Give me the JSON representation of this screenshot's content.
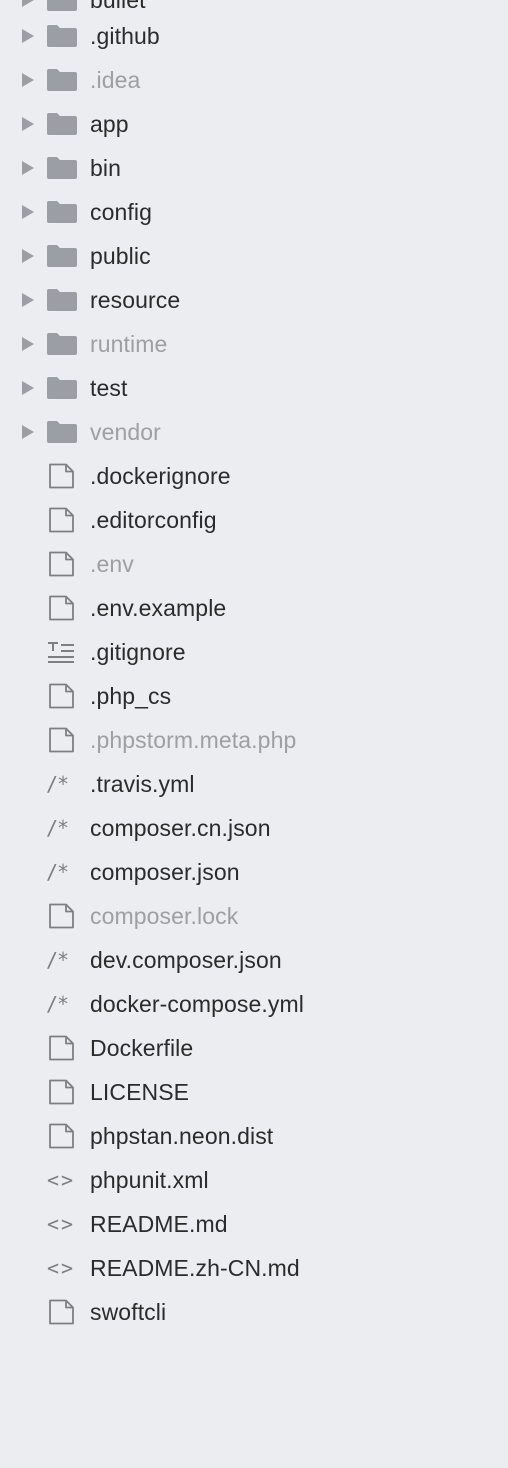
{
  "partial_top_item": {
    "name": "bullet",
    "kind": "folder"
  },
  "items": [
    {
      "name": ".github",
      "kind": "folder",
      "dim": false,
      "icon": "folder-icon"
    },
    {
      "name": ".idea",
      "kind": "folder",
      "dim": true,
      "icon": "folder-icon"
    },
    {
      "name": "app",
      "kind": "folder",
      "dim": false,
      "icon": "folder-icon"
    },
    {
      "name": "bin",
      "kind": "folder",
      "dim": false,
      "icon": "folder-icon"
    },
    {
      "name": "config",
      "kind": "folder",
      "dim": false,
      "icon": "folder-icon"
    },
    {
      "name": "public",
      "kind": "folder",
      "dim": false,
      "icon": "folder-icon"
    },
    {
      "name": "resource",
      "kind": "folder",
      "dim": false,
      "icon": "folder-icon"
    },
    {
      "name": "runtime",
      "kind": "folder",
      "dim": true,
      "icon": "folder-icon"
    },
    {
      "name": "test",
      "kind": "folder",
      "dim": false,
      "icon": "folder-icon"
    },
    {
      "name": "vendor",
      "kind": "folder",
      "dim": true,
      "icon": "folder-icon"
    },
    {
      "name": ".dockerignore",
      "kind": "file",
      "dim": false,
      "icon": "document-icon"
    },
    {
      "name": ".editorconfig",
      "kind": "file",
      "dim": false,
      "icon": "document-icon"
    },
    {
      "name": ".env",
      "kind": "file",
      "dim": true,
      "icon": "document-icon"
    },
    {
      "name": ".env.example",
      "kind": "file",
      "dim": false,
      "icon": "document-icon"
    },
    {
      "name": ".gitignore",
      "kind": "file",
      "dim": false,
      "icon": "text-lines-icon"
    },
    {
      "name": ".php_cs",
      "kind": "file",
      "dim": false,
      "icon": "document-icon"
    },
    {
      "name": ".phpstorm.meta.php",
      "kind": "file",
      "dim": true,
      "icon": "document-icon"
    },
    {
      "name": ".travis.yml",
      "kind": "file",
      "dim": false,
      "icon": "comment-icon"
    },
    {
      "name": "composer.cn.json",
      "kind": "file",
      "dim": false,
      "icon": "comment-icon"
    },
    {
      "name": "composer.json",
      "kind": "file",
      "dim": false,
      "icon": "comment-icon"
    },
    {
      "name": "composer.lock",
      "kind": "file",
      "dim": true,
      "icon": "document-icon"
    },
    {
      "name": "dev.composer.json",
      "kind": "file",
      "dim": false,
      "icon": "comment-icon"
    },
    {
      "name": "docker-compose.yml",
      "kind": "file",
      "dim": false,
      "icon": "comment-icon"
    },
    {
      "name": "Dockerfile",
      "kind": "file",
      "dim": false,
      "icon": "document-icon"
    },
    {
      "name": "LICENSE",
      "kind": "file",
      "dim": false,
      "icon": "document-icon"
    },
    {
      "name": "phpstan.neon.dist",
      "kind": "file",
      "dim": false,
      "icon": "document-icon"
    },
    {
      "name": "phpunit.xml",
      "kind": "file",
      "dim": false,
      "icon": "markup-icon"
    },
    {
      "name": "README.md",
      "kind": "file",
      "dim": false,
      "icon": "markup-icon"
    },
    {
      "name": "README.zh-CN.md",
      "kind": "file",
      "dim": false,
      "icon": "markup-icon"
    },
    {
      "name": "swoftcli",
      "kind": "file",
      "dim": false,
      "icon": "document-icon"
    }
  ],
  "colors": {
    "background": "#ecedf0",
    "text": "#2b2b2b",
    "dim_text": "#9d9fa4",
    "icon": "#9b9ea4"
  }
}
